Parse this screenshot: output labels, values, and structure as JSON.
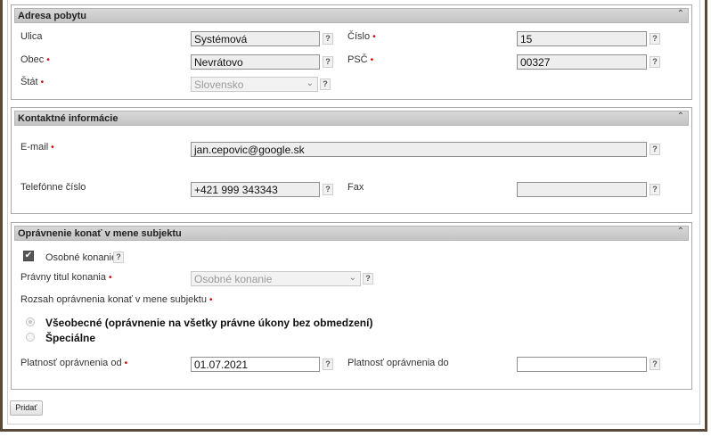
{
  "address": {
    "title": "Adresa pobytu",
    "street_label": "Ulica",
    "street_value": "Systémová",
    "number_label": "Číslo",
    "number_value": "15",
    "city_label": "Obec",
    "city_value": "Nevrátovo",
    "zip_label": "PSČ",
    "zip_value": "00327",
    "country_label": "Štát",
    "country_value": "Slovensko"
  },
  "contact": {
    "title": "Kontaktné informácie",
    "email_label": "E-mail",
    "email_value": "jan.cepovic@google.sk",
    "phone_label": "Telefónne číslo",
    "phone_value": "+421 999 343343",
    "fax_label": "Fax",
    "fax_value": ""
  },
  "authorization": {
    "title": "Oprávnenie konať v mene subjektu",
    "personal_label": "Osobné konanie",
    "personal_checked": true,
    "legal_title_label": "Právny titul konania",
    "legal_title_value": "Osobné konanie",
    "scope_label": "Rozsah oprávnenia konať v mene subjektu",
    "scope_options": [
      {
        "label": "Všeobecné (oprávnenie na všetky právne úkony bez obmedzení)",
        "selected": true
      },
      {
        "label": "Špeciálne",
        "selected": false
      }
    ],
    "valid_from_label": "Platnosť oprávnenia od",
    "valid_from_value": "01.07.2021",
    "valid_to_label": "Platnosť oprávnenia do",
    "valid_to_value": ""
  },
  "common": {
    "required_mark": "•",
    "help_mark": "?",
    "collapse_mark": "⌃",
    "dropdown_mark": "⌄",
    "check_mark": "✔"
  },
  "add_button_label": "Pridať"
}
